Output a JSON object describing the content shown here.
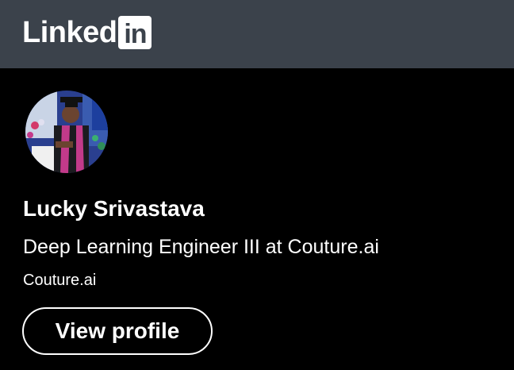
{
  "header": {
    "logo_text": "Linked",
    "logo_box_text": "in",
    "background_color": "#3b424b"
  },
  "profile": {
    "avatar_icon": "profile-photo",
    "name": "Lucky Srivastava",
    "headline": "Deep Learning Engineer III at Couture.ai",
    "company": "Couture.ai",
    "view_profile_label": "View profile"
  },
  "colors": {
    "card_background": "#000000",
    "text": "#ffffff"
  }
}
